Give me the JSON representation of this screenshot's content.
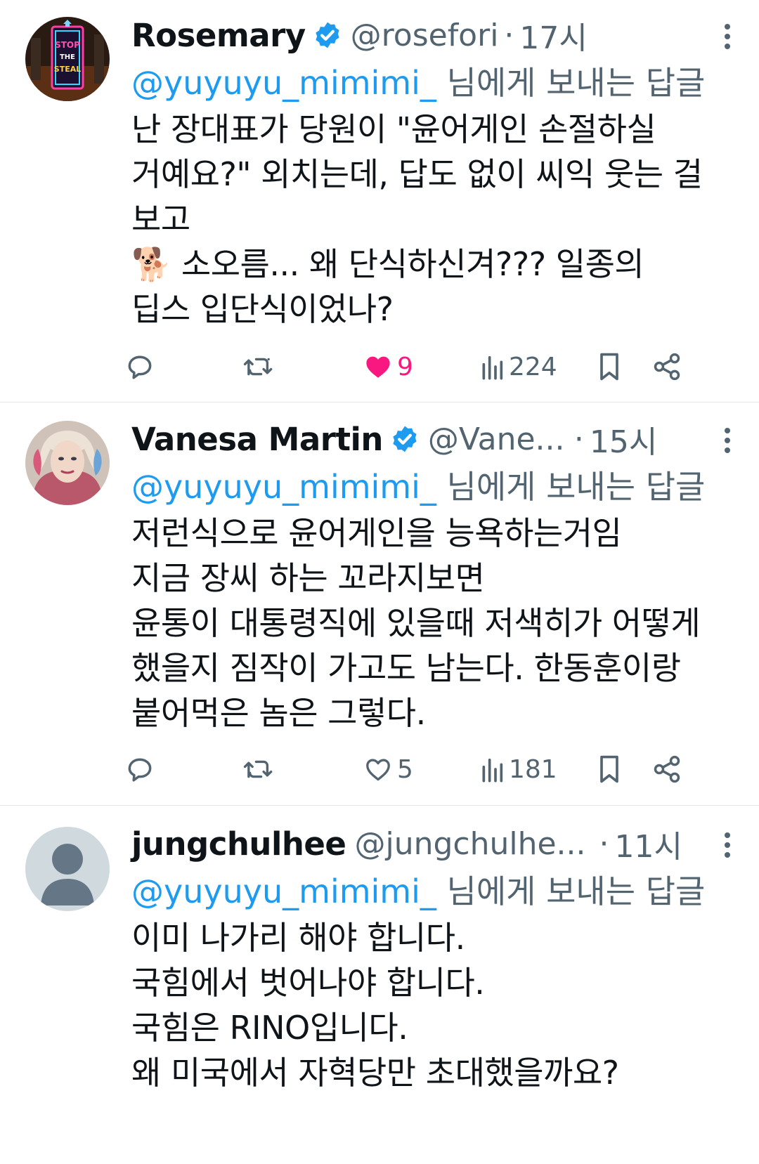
{
  "replying_to_suffix": " 님에게 보내는 답글",
  "tweets": [
    {
      "name": "Rosemary",
      "handle": "@rosefori",
      "dot": "·",
      "time": "17시",
      "reply_to": "@yuyuyu_mimimi_",
      "text": "난 장대표가 당원이 \"윤어게인 손절하실\n거예요?\" 외치는데, 답도 없이 씨익 웃는 걸\n보고\n🐕 소오름... 왜 단식하신겨??? 일종의\n딥스 입단식이었나?",
      "verified": true,
      "avatar_icon": "stop-the-steal-neon-avatar",
      "avatar_text": "STOP THE STEAL",
      "likes": "9",
      "liked": true,
      "views": "224"
    },
    {
      "name": "Vanesa Martin",
      "handle": "@Vane...",
      "dot": "·",
      "time": "15시",
      "reply_to": "@yuyuyu_mimimi_",
      "text": "저런식으로 윤어게인을 능욕하는거임\n지금 장씨 하는 꼬라지보면\n윤통이 대통령직에 있을때 저색히가 어떻게\n했을지 짐작이 가고도 남는다. 한동훈이랑\n붙어먹은 놈은 그렇다.",
      "verified": true,
      "avatar_icon": "portrait-avatar",
      "likes": "5",
      "liked": false,
      "views": "181"
    },
    {
      "name": "jungchulhee",
      "handle": "@jungchulhe...",
      "dot": "·",
      "time": "11시",
      "reply_to": "@yuyuyu_mimimi_",
      "text": "이미 나가리 해야 합니다.\n국힘에서 벗어나야 합니다.\n국힘은 RINO입니다.\n왜 미국에서 자혁당만 초대했을까요?",
      "verified": false,
      "avatar_icon": "default-person-avatar"
    }
  ],
  "colors": {
    "text": "#0f1419",
    "secondary": "#536471",
    "mention": "#1d9bf0",
    "like": "#f91880",
    "verified": "#1d9bf0",
    "divider": "#e3e7ea"
  }
}
